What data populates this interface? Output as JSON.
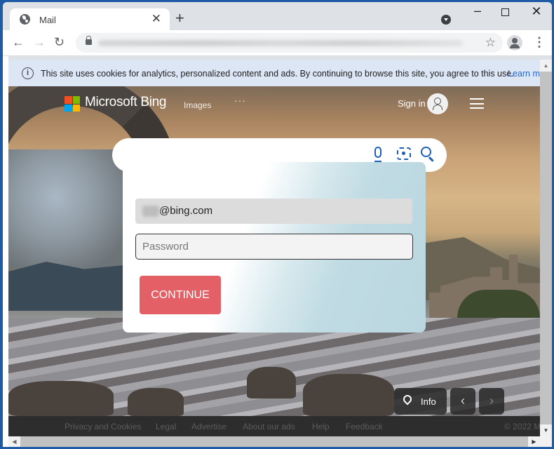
{
  "browser": {
    "tab": {
      "title": "Mail",
      "close": "✕"
    },
    "new_tab": "+",
    "window_controls": {
      "minimize": "–",
      "close": "✕"
    },
    "nav": {
      "back": "←",
      "forward": "→",
      "reload": "↻"
    },
    "bookmark": "☆",
    "menu": "⋮"
  },
  "cookie_banner": {
    "icon": "i",
    "message": "This site uses cookies for analytics, personalized content and ads. By continuing to browse this site, you agree to this use.",
    "link": "Learn m"
  },
  "bing": {
    "brand": "Microsoft Bing",
    "logo_colors": [
      "#f25022",
      "#7fba00",
      "#00a4ef",
      "#ffb900"
    ],
    "nav_images": "Images",
    "nav_more": "···",
    "sign_in": "Sign in"
  },
  "login": {
    "email_value": "@bing.com",
    "password_placeholder": "Password",
    "continue_label": "CONTINUE",
    "accent": "#e26066"
  },
  "image_controls": {
    "info_label": "Info",
    "prev": "‹",
    "next": "›"
  },
  "footer": {
    "links": [
      "Privacy and Cookies",
      "Legal",
      "Advertise",
      "About our ads",
      "Help",
      "Feedback"
    ],
    "copyright": "© 2022 M"
  },
  "scrollbars": {
    "up": "▲",
    "down": "▼",
    "left": "◀",
    "right": "▶"
  }
}
